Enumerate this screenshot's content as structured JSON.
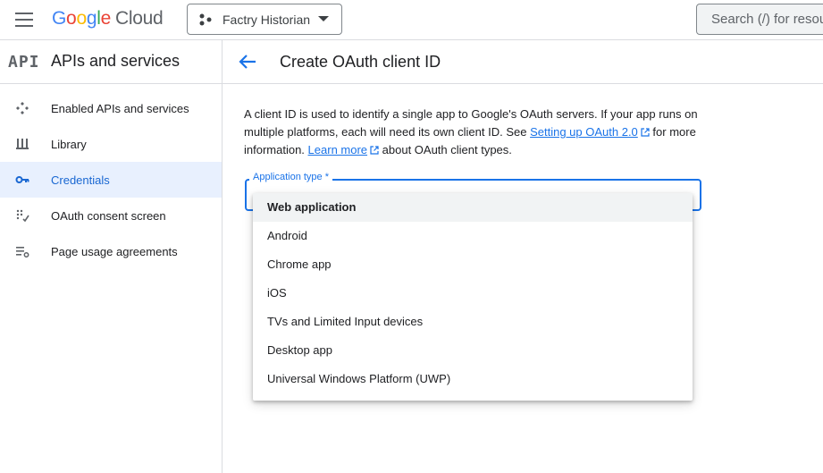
{
  "topbar": {
    "logo": {
      "google": "Google",
      "cloud": "Cloud"
    },
    "project": "Factry Historian",
    "search_placeholder": "Search (/) for resources"
  },
  "sidebar": {
    "badge": "API",
    "title": "APIs and services",
    "items": [
      {
        "label": "Enabled APIs and services",
        "icon": "enabled-apis-icon"
      },
      {
        "label": "Library",
        "icon": "library-icon"
      },
      {
        "label": "Credentials",
        "icon": "key-icon",
        "active": true
      },
      {
        "label": "OAuth consent screen",
        "icon": "consent-icon"
      },
      {
        "label": "Page usage agreements",
        "icon": "settings-list-icon"
      }
    ]
  },
  "page": {
    "title": "Create OAuth client ID",
    "desc_1": "A client ID is used to identify a single app to Google's OAuth servers. If your app runs on multiple platforms, each will need its own client ID. See ",
    "link_1": "Setting up OAuth 2.0",
    "desc_2": " for more information. ",
    "link_2": "Learn more",
    "desc_3": " about OAuth client types."
  },
  "form": {
    "app_type_label": "Application type *",
    "options": [
      "Web application",
      "Android",
      "Chrome app",
      "iOS",
      "TVs and Limited Input devices",
      "Desktop app",
      "Universal Windows Platform (UWP)"
    ],
    "selected_index": 0
  },
  "colors": {
    "accent": "#1a73e8",
    "active_bg": "#e8f0fe"
  }
}
